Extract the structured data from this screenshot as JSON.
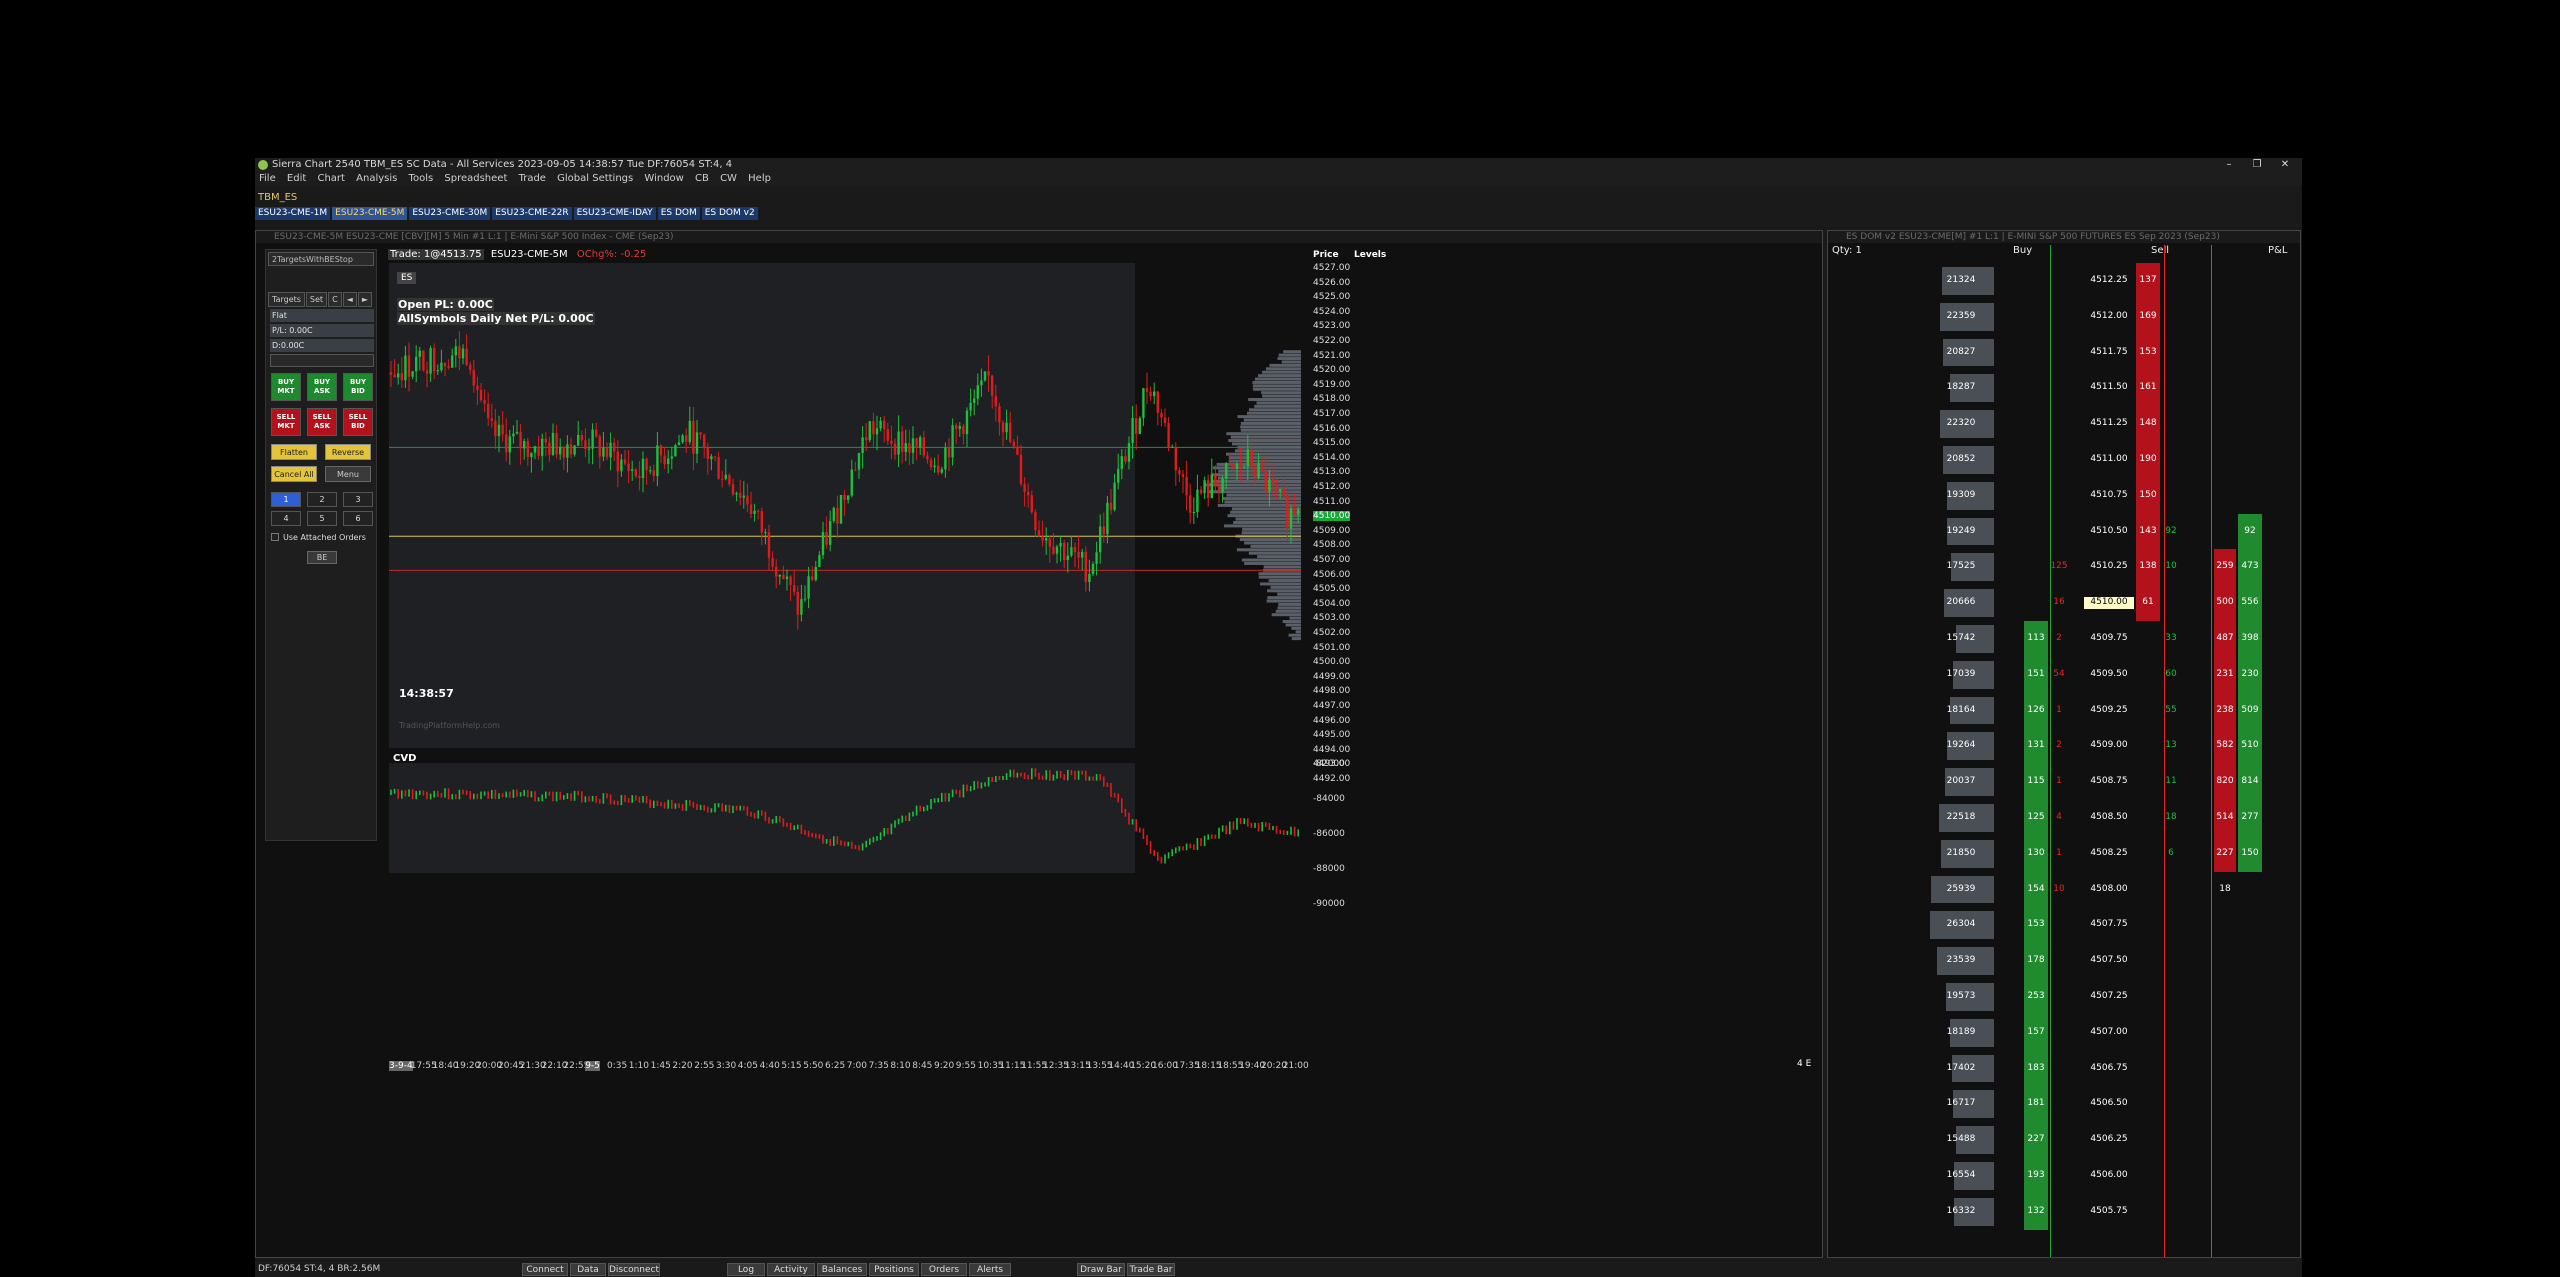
{
  "window": {
    "title": "Sierra Chart 2540 TBM_ES SC Data - All Services 2023-09-05  14:38:57 Tue  DF:76054  ST:4, 4",
    "controls": [
      "–",
      "❐",
      "✕"
    ]
  },
  "menu": [
    "File",
    "Edit",
    "Chart",
    "Analysis",
    "Tools",
    "Spreadsheet",
    "Trade",
    "Global Settings",
    "Window",
    "CB",
    "CW",
    "Help"
  ],
  "workspace_label": "TBM_ES",
  "tabs": [
    {
      "label": "ESU23-CME-1M",
      "active": false
    },
    {
      "label": "ESU23-CME-5M",
      "active": true
    },
    {
      "label": "ESU23-CME-30M",
      "active": false
    },
    {
      "label": "ESU23-CME-22R",
      "active": false
    },
    {
      "label": "ESU23-CME-IDAY",
      "active": false
    },
    {
      "label": "ES DOM",
      "active": false
    },
    {
      "label": "ES DOM v2",
      "active": false
    }
  ],
  "chart_window": {
    "title": "ESU23-CME-5M  ESU23-CME [CBV][M] 5 Min  #1 L:1 | E-Mini S&P 500 Index - CME (Sep23)",
    "trade_info": "Trade: 1@4513.75",
    "symbol": "ESU23-CME-5M",
    "change": "OChg%: -0.25",
    "es_tag": "ES",
    "open_pl": "Open PL: 0.00C",
    "daily_pl": "AllSymbols Daily Net P/L: 0.00C",
    "clock": "14:38:57",
    "watermark": "TradingPlatformHelp.com",
    "cvd_label": "CVD",
    "price_header": "Price",
    "levels_header": "Levels",
    "corner": "4 E",
    "price_labels": [
      "4527.00",
      "4526.00",
      "4525.00",
      "4524.00",
      "4523.00",
      "4522.00",
      "4521.00",
      "4520.00",
      "4519.00",
      "4518.00",
      "4517.00",
      "4516.00",
      "4515.00",
      "4514.00",
      "4513.00",
      "4512.00",
      "4511.00",
      "4510.00",
      "4509.00",
      "4508.00",
      "4507.00",
      "4506.00",
      "4505.00",
      "4504.00",
      "4503.00",
      "4502.00",
      "4501.00",
      "4500.00",
      "4499.00",
      "4498.00",
      "4497.00",
      "4496.00",
      "4495.00",
      "4494.00",
      "4493.00",
      "4492.00"
    ],
    "current_price": "4510.00",
    "cvd_labels": [
      "-82000",
      "-84000",
      "-86000",
      "-88000",
      "-90000"
    ],
    "time_labels": [
      "3-9-4",
      "17:55",
      "18:40",
      "19:20",
      "20:00",
      "20:45",
      "21:30",
      "22:10",
      "22:55",
      "9-5",
      "0:35",
      "1:10",
      "1:45",
      "2:20",
      "2:55",
      "3:30",
      "4:05",
      "4:40",
      "5:15",
      "5:50",
      "6:25",
      "7:00",
      "7:35",
      "8:10",
      "8:45",
      "9:20",
      "9:55",
      "10:35",
      "11:15",
      "11:55",
      "12:35",
      "13:15",
      "13:55",
      "14:40",
      "15:20",
      "16:00",
      "17:35",
      "18:15",
      "18:55",
      "19:40",
      "20:20",
      "21:00"
    ]
  },
  "trade_panel": {
    "strategy": "2TargetsWithBEStop",
    "tabs": [
      "Targets",
      "Set",
      "C",
      "◄",
      "►"
    ],
    "position": "Flat",
    "pl": "P/L: 0.00C",
    "daily": "D:0.00C",
    "buy_buttons": [
      "BUY\nMKT",
      "BUY\nASK",
      "BUY\nBID"
    ],
    "sell_buttons": [
      "SELL\nMKT",
      "SELL\nASK",
      "SELL\nBID"
    ],
    "flatten": "Flatten",
    "reverse": "Reverse",
    "cancel_all": "Cancel All",
    "menu": "Menu",
    "qty": [
      "1",
      "2",
      "3",
      "4",
      "5",
      "6"
    ],
    "attached": "Use Attached Orders",
    "be": "BE"
  },
  "dom": {
    "title": "ES DOM v2  ESU23-CME[M]  #1 L:1 | E-MINI S&P 500 FUTURES ES Sep 2023 (Sep23)",
    "qty": "Qty: 1",
    "buy_header": "Buy",
    "sell_header": "Sell",
    "pl_header": "P&L",
    "rows": [
      {
        "vol": "21324",
        "bid": "",
        "bv": "",
        "price": "4512.25",
        "ask": "137",
        "sv": "",
        "a": "",
        "b": ""
      },
      {
        "vol": "22359",
        "bid": "",
        "bv": "",
        "price": "4512.00",
        "ask": "169",
        "sv": "",
        "a": "",
        "b": ""
      },
      {
        "vol": "20827",
        "bid": "",
        "bv": "",
        "price": "4511.75",
        "ask": "153",
        "sv": "",
        "a": "",
        "b": ""
      },
      {
        "vol": "18287",
        "bid": "",
        "bv": "",
        "price": "4511.50",
        "ask": "161",
        "sv": "",
        "a": "",
        "b": ""
      },
      {
        "vol": "22320",
        "bid": "",
        "bv": "",
        "price": "4511.25",
        "ask": "148",
        "sv": "",
        "a": "",
        "b": ""
      },
      {
        "vol": "20852",
        "bid": "",
        "bv": "",
        "price": "4511.00",
        "ask": "190",
        "sv": "",
        "a": "",
        "b": ""
      },
      {
        "vol": "19309",
        "bid": "",
        "bv": "",
        "price": "4510.75",
        "ask": "150",
        "sv": "",
        "a": "",
        "b": ""
      },
      {
        "vol": "19249",
        "bid": "",
        "bv": "",
        "price": "4510.50",
        "ask": "143",
        "sv": "92",
        "a": "",
        "b": "92"
      },
      {
        "vol": "17525",
        "bid": "",
        "bv": "125",
        "price": "4510.25",
        "ask": "138",
        "sv": "10",
        "a": "259",
        "b": "473"
      },
      {
        "vol": "20666",
        "bid": "",
        "bv": "16",
        "price": "4510.00",
        "ask": "61",
        "sv": "",
        "a": "500",
        "b": "556"
      },
      {
        "vol": "15742",
        "bid": "113",
        "bv": "2",
        "price": "4509.75",
        "ask": "",
        "sv": "33",
        "a": "487",
        "b": "398"
      },
      {
        "vol": "17039",
        "bid": "151",
        "bv": "54",
        "price": "4509.50",
        "ask": "",
        "sv": "60",
        "a": "231",
        "b": "230"
      },
      {
        "vol": "18164",
        "bid": "126",
        "bv": "1",
        "price": "4509.25",
        "ask": "",
        "sv": "55",
        "a": "238",
        "b": "509"
      },
      {
        "vol": "19264",
        "bid": "131",
        "bv": "2",
        "price": "4509.00",
        "ask": "",
        "sv": "13",
        "a": "582",
        "b": "510"
      },
      {
        "vol": "20037",
        "bid": "115",
        "bv": "1",
        "price": "4508.75",
        "ask": "",
        "sv": "11",
        "a": "820",
        "b": "814"
      },
      {
        "vol": "22518",
        "bid": "125",
        "bv": "4",
        "price": "4508.50",
        "ask": "",
        "sv": "18",
        "a": "514",
        "b": "277"
      },
      {
        "vol": "21850",
        "bid": "130",
        "bv": "1",
        "price": "4508.25",
        "ask": "",
        "sv": "6",
        "a": "227",
        "b": "150"
      },
      {
        "vol": "25939",
        "bid": "154",
        "bv": "10",
        "price": "4508.00",
        "ask": "",
        "sv": "",
        "a": "18",
        "b": ""
      },
      {
        "vol": "26304",
        "bid": "153",
        "bv": "",
        "price": "4507.75",
        "ask": "",
        "sv": "",
        "a": "",
        "b": ""
      },
      {
        "vol": "23539",
        "bid": "178",
        "bv": "",
        "price": "4507.50",
        "ask": "",
        "sv": "",
        "a": "",
        "b": ""
      },
      {
        "vol": "19573",
        "bid": "253",
        "bv": "",
        "price": "4507.25",
        "ask": "",
        "sv": "",
        "a": "",
        "b": ""
      },
      {
        "vol": "18189",
        "bid": "157",
        "bv": "",
        "price": "4507.00",
        "ask": "",
        "sv": "",
        "a": "",
        "b": ""
      },
      {
        "vol": "17402",
        "bid": "183",
        "bv": "",
        "price": "4506.75",
        "ask": "",
        "sv": "",
        "a": "",
        "b": ""
      },
      {
        "vol": "16717",
        "bid": "181",
        "bv": "",
        "price": "4506.50",
        "ask": "",
        "sv": "",
        "a": "",
        "b": ""
      },
      {
        "vol": "15488",
        "bid": "227",
        "bv": "",
        "price": "4506.25",
        "ask": "",
        "sv": "",
        "a": "",
        "b": ""
      },
      {
        "vol": "16554",
        "bid": "193",
        "bv": "",
        "price": "4506.00",
        "ask": "",
        "sv": "",
        "a": "",
        "b": ""
      },
      {
        "vol": "16332",
        "bid": "132",
        "bv": "",
        "price": "4505.75",
        "ask": "",
        "sv": "",
        "a": "",
        "b": ""
      }
    ]
  },
  "status": {
    "left": "DF:76054  ST:4, 4  BR:2.56M",
    "buttons": [
      "Connect",
      "Data",
      "Disconnect",
      "Log",
      "Activity",
      "Balances",
      "Positions",
      "Orders",
      "Alerts",
      "Draw Bar",
      "Trade Bar"
    ]
  },
  "colors": {
    "up": "#19c23a",
    "down": "#e01b1b",
    "profile": "#5a5f68",
    "hline_green": "#2e8b3a",
    "hline_yellow": "#d6c65a",
    "hline_red": "#c0282a"
  }
}
